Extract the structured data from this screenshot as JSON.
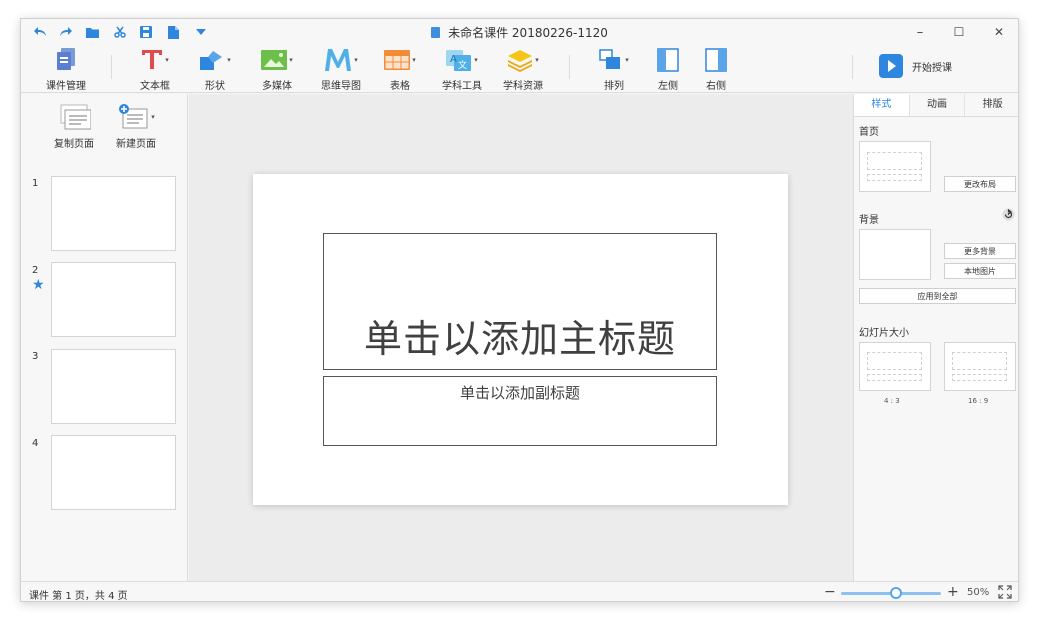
{
  "app": {
    "title": "未命名课件 20180226-1120"
  },
  "quick_access": [
    {
      "name": "undo-icon"
    },
    {
      "name": "redo-icon"
    },
    {
      "name": "folder-icon"
    },
    {
      "name": "scissors-icon"
    },
    {
      "name": "save-icon"
    },
    {
      "name": "file-icon"
    },
    {
      "name": "dropdown-icon"
    }
  ],
  "window_controls": {
    "minimize": "–",
    "maximize": "☐",
    "close": "✕"
  },
  "ribbon": {
    "courseware": "课件管理",
    "textbox": "文本框",
    "shape": "形状",
    "media": "多媒体",
    "mindmap": "思维导图",
    "table": "表格",
    "subject_tools": "学科工具",
    "subject_resources": "学科资源",
    "arrange": "排列",
    "left_side": "左侧",
    "right_side": "右侧",
    "start_teaching": "开始授课"
  },
  "left_panel": {
    "copy_page": "复制页面",
    "new_page": "新建页面",
    "thumbnails": [
      {
        "num": "1",
        "starred": false
      },
      {
        "num": "2",
        "starred": true
      },
      {
        "num": "3",
        "starred": false
      },
      {
        "num": "4",
        "starred": false
      }
    ]
  },
  "slide": {
    "main_title": "单击以添加主标题",
    "subtitle": "单击以添加副标题"
  },
  "right_panel": {
    "tabs": [
      "样式",
      "动画",
      "排版"
    ],
    "active_tab": "样式",
    "home_label": "首页",
    "change_layout": "更改布局",
    "background_label": "背景",
    "more_backgrounds": "更多背景",
    "local_image": "本地图片",
    "apply_all": "应用到全部",
    "slide_size_label": "幻灯片大小",
    "ratio_4_3": "4 : 3",
    "ratio_16_9": "16 : 9"
  },
  "status": {
    "page_info": "课件 第 1 页，共 4 页",
    "zoom": "50%",
    "zoom_fraction": 0.5
  },
  "colors": {
    "accent": "#2e86de",
    "textbox_red": "#e04b4b",
    "media_green": "#6cc04a",
    "mindmap_blue": "#4fb0e8",
    "table_orange": "#f28c38",
    "resource_yellow": "#f5c518"
  }
}
